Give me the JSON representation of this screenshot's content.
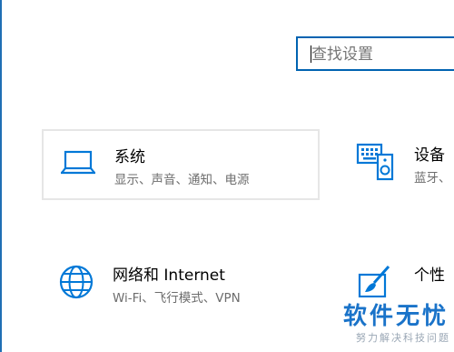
{
  "search": {
    "placeholder": "查找设置"
  },
  "tiles": [
    {
      "title": "系统",
      "subtitle": "显示、声音、通知、电源",
      "icon": "laptop-icon"
    },
    {
      "title": "设备",
      "subtitle": "蓝牙、",
      "icon": "devices-icon"
    },
    {
      "title": "网络和 Internet",
      "subtitle": "Wi-Fi、飞行模式、VPN",
      "icon": "globe-icon"
    },
    {
      "title": "个性",
      "subtitle": "",
      "icon": "paintbrush-icon"
    }
  ],
  "watermark": {
    "title": "软件无忧",
    "subtitle": "努力解决科技问题"
  },
  "colors": {
    "accent": "#0063b1",
    "icon": "#0078d7",
    "watermark": "#1a73c9"
  }
}
